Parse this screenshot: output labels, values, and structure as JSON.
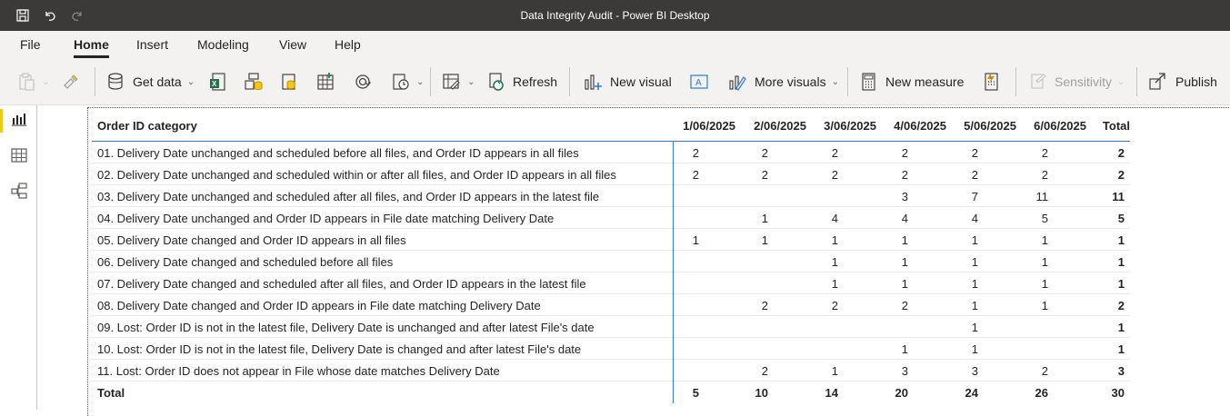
{
  "window": {
    "title": "Data Integrity Audit - Power BI Desktop",
    "quick_access": [
      "save-icon",
      "undo-icon",
      "redo-icon"
    ]
  },
  "menu": {
    "tabs": [
      "File",
      "Home",
      "Insert",
      "Modeling",
      "View",
      "Help"
    ],
    "active": "Home"
  },
  "ribbon": {
    "get_data": "Get data",
    "refresh": "Refresh",
    "new_visual": "New visual",
    "more_visuals": "More visuals",
    "new_measure": "New measure",
    "sensitivity": "Sensitivity",
    "publish": "Publish"
  },
  "colors": {
    "titlebar": "#3b3a39",
    "ribbon_bg": "#f3f2f1",
    "accent_blue": "#2b7cd3",
    "active_view": "#f2c811",
    "excel_green": "#217346",
    "dataverse_orange": "#d08b00"
  },
  "matrix": {
    "header": {
      "category": "Order ID category",
      "dates": [
        "1/06/2025",
        "2/06/2025",
        "3/06/2025",
        "4/06/2025",
        "5/06/2025",
        "6/06/2025"
      ],
      "total": "Total"
    },
    "rows": [
      {
        "category": "01. Delivery Date unchanged and scheduled before all files, and Order ID appears in all files",
        "values": [
          "2",
          "2",
          "2",
          "2",
          "2",
          "2"
        ],
        "total": "2"
      },
      {
        "category": "02. Delivery Date unchanged and scheduled within or after all files, and Order ID appears in all files",
        "values": [
          "2",
          "2",
          "2",
          "2",
          "2",
          "2"
        ],
        "total": "2"
      },
      {
        "category": "03. Delivery Date unchanged and scheduled after all files, and Order ID appears in the latest file",
        "values": [
          "",
          "",
          "",
          "3",
          "7",
          "11"
        ],
        "total": "11"
      },
      {
        "category": "04. Delivery Date unchanged and Order ID appears in File date matching Delivery Date",
        "values": [
          "",
          "1",
          "4",
          "4",
          "4",
          "5"
        ],
        "total": "5"
      },
      {
        "category": "05. Delivery Date changed and Order ID appears in all files",
        "values": [
          "1",
          "1",
          "1",
          "1",
          "1",
          "1"
        ],
        "total": "1"
      },
      {
        "category": "06. Delivery Date changed and scheduled before all files",
        "values": [
          "",
          "",
          "1",
          "1",
          "1",
          "1"
        ],
        "total": "1"
      },
      {
        "category": "07. Delivery Date changed and scheduled after all files, and Order ID appears in the latest file",
        "values": [
          "",
          "",
          "1",
          "1",
          "1",
          "1"
        ],
        "total": "1"
      },
      {
        "category": "08. Delivery Date changed and Order ID appears in File date matching Delivery Date",
        "values": [
          "",
          "2",
          "2",
          "2",
          "1",
          "1"
        ],
        "total": "2"
      },
      {
        "category": "09. Lost: Order ID is not in the latest file, Delivery Date is unchanged and after latest File's date",
        "values": [
          "",
          "",
          "",
          "",
          "1",
          ""
        ],
        "total": "1"
      },
      {
        "category": "10. Lost: Order ID is not in the latest file, Delivery Date is changed and after latest File's date",
        "values": [
          "",
          "",
          "",
          "1",
          "1",
          ""
        ],
        "total": "1"
      },
      {
        "category": "11. Lost: Order ID does not appear in File whose date matches Delivery Date",
        "values": [
          "",
          "2",
          "1",
          "3",
          "3",
          "2"
        ],
        "total": "3"
      }
    ],
    "totals": {
      "label": "Total",
      "values": [
        "5",
        "10",
        "14",
        "20",
        "24",
        "26"
      ],
      "total": "30"
    }
  }
}
